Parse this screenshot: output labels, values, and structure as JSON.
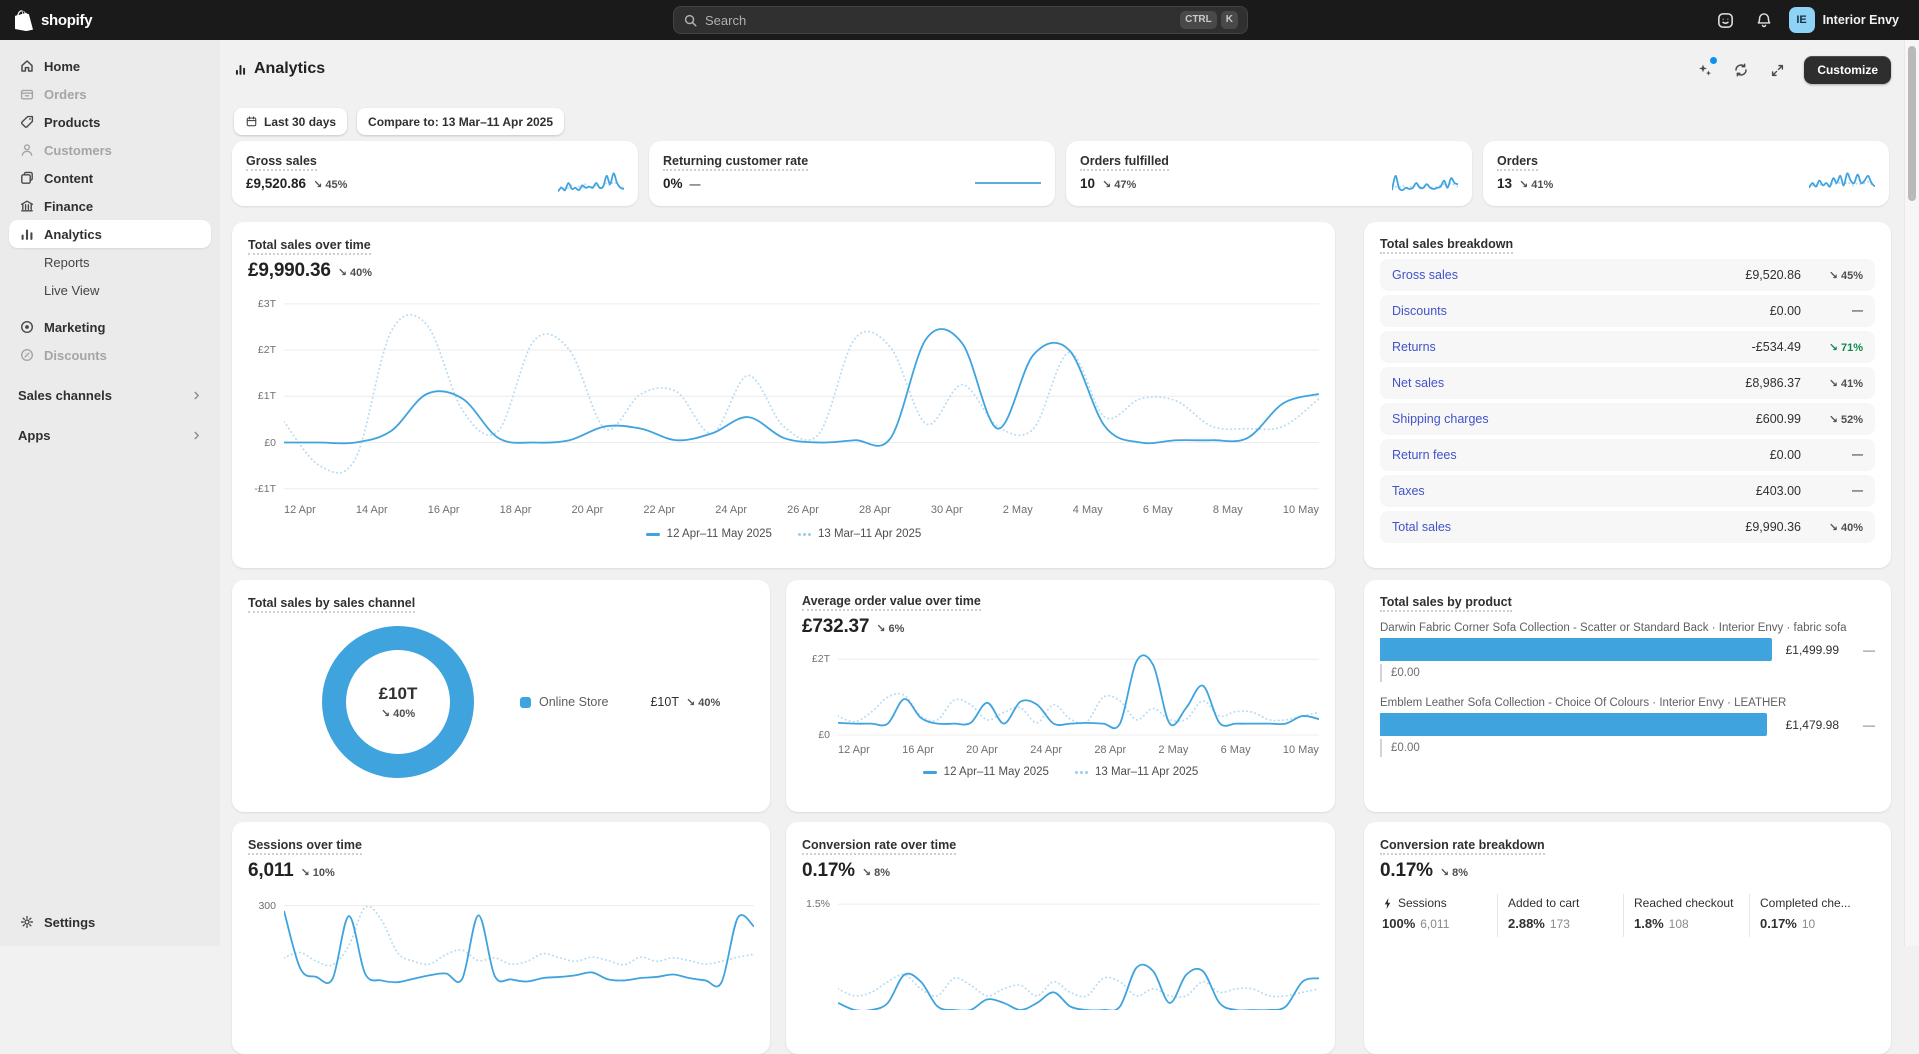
{
  "topbar": {
    "brand": "shopify",
    "search": {
      "placeholder": "Search",
      "keys": [
        "CTRL",
        "K"
      ]
    },
    "store": {
      "initials": "IE",
      "name": "Interior Envy"
    }
  },
  "sidebar": {
    "items": [
      {
        "label": "Home"
      },
      {
        "label": "Orders"
      },
      {
        "label": "Products"
      },
      {
        "label": "Customers"
      },
      {
        "label": "Content"
      },
      {
        "label": "Finance"
      },
      {
        "label": "Analytics"
      },
      {
        "label": "Reports"
      },
      {
        "label": "Live View"
      },
      {
        "label": "Marketing"
      },
      {
        "label": "Discounts"
      }
    ],
    "sections": [
      {
        "label": "Sales channels"
      },
      {
        "label": "Apps"
      }
    ],
    "settings": "Settings"
  },
  "header": {
    "title": "Analytics",
    "customize": "Customize"
  },
  "filters": {
    "range": "Last 30 days",
    "compare": "Compare to: 13 Mar–11 Apr 2025"
  },
  "metrics": [
    {
      "title": "Gross sales",
      "value": "£9,520.86",
      "change": "↘ 45%"
    },
    {
      "title": "Returning customer rate",
      "value": "0%",
      "change": "—"
    },
    {
      "title": "Orders fulfilled",
      "value": "10",
      "change": "↘ 47%"
    },
    {
      "title": "Orders",
      "value": "13",
      "change": "↘ 41%"
    }
  ],
  "big_chart": {
    "title": "Total sales over time",
    "value": "£9,990.36",
    "change": "↘ 40%",
    "legend_current": "12 Apr–11 May 2025",
    "legend_compare": "13 Mar–11 Apr 2025"
  },
  "breakdown": {
    "title": "Total sales breakdown",
    "rows": [
      {
        "label": "Gross sales",
        "value": "£9,520.86",
        "change": "↘ 45%"
      },
      {
        "label": "Discounts",
        "value": "£0.00",
        "change": "—"
      },
      {
        "label": "Returns",
        "value": "-£534.49",
        "change": "↘ 71%",
        "color": "#0f8a4e"
      },
      {
        "label": "Net sales",
        "value": "£8,986.37",
        "change": "↘ 41%"
      },
      {
        "label": "Shipping charges",
        "value": "£600.99",
        "change": "↘ 52%"
      },
      {
        "label": "Return fees",
        "value": "£0.00",
        "change": "—"
      },
      {
        "label": "Taxes",
        "value": "£403.00",
        "change": "—"
      },
      {
        "label": "Total sales",
        "value": "£9,990.36",
        "change": "↘ 40%"
      }
    ]
  },
  "channel": {
    "title": "Total sales by sales channel",
    "center_value": "£10T",
    "center_change": "↘ 40%",
    "legend_name": "Online Store",
    "legend_value": "£10T",
    "legend_change": "↘ 40%"
  },
  "aov": {
    "title": "Average order value over time",
    "value": "£732.37",
    "change": "↘ 6%",
    "legend_current": "12 Apr–11 May 2025",
    "legend_compare": "13 Mar–11 Apr 2025"
  },
  "product_sales": {
    "title": "Total sales by product",
    "axis_max": 1512,
    "items": [
      {
        "label": "Darwin Fabric Corner Sofa Collection - Scatter or Standard Back · Interior Envy · fabric sofa",
        "value": "£1,499.99",
        "value_num": 1499.99,
        "change": "—",
        "compare_value": "£0.00"
      },
      {
        "label": "Emblem Leather Sofa Collection - Choice Of Colours · Interior Envy · LEATHER",
        "value": "£1,479.98",
        "value_num": 1479.98,
        "change": "—",
        "compare_value": "£0.00"
      }
    ]
  },
  "sessions": {
    "title": "Sessions over time",
    "value": "6,011",
    "change": "↘ 10%"
  },
  "conversion": {
    "title": "Conversion rate over time",
    "value": "0.17%",
    "change": "↘ 8%"
  },
  "funnel": {
    "title": "Conversion rate breakdown",
    "value": "0.17%",
    "change": "↘ 8%",
    "columns": [
      {
        "label": "Sessions",
        "pct": "100%",
        "count": "6,011"
      },
      {
        "label": "Added to cart",
        "pct": "2.88%",
        "count": "173"
      },
      {
        "label": "Reached checkout",
        "pct": "1.8%",
        "count": "108"
      },
      {
        "label": "Completed che...",
        "pct": "0.17%",
        "count": "10"
      }
    ]
  },
  "colors": {
    "accent_blue": "#3fa3de",
    "compare_blue": "#b7dcf4",
    "link": "#4053c8",
    "green": "#0f8a4e"
  },
  "charts": {
    "total_sales": {
      "type": "line",
      "ylim": [
        -1.2,
        3.3
      ],
      "color": "#3fa3de",
      "compare_color": "#b7dcf4",
      "yticks": [
        {
          "label": "£3T",
          "value": 3
        },
        {
          "label": "£2T",
          "value": 2
        },
        {
          "label": "£1T",
          "value": 1
        },
        {
          "label": "£0",
          "value": 0
        },
        {
          "label": "-£1T",
          "value": -1
        }
      ],
      "xlabels": [
        "12 Apr",
        "14 Apr",
        "16 Apr",
        "18 Apr",
        "20 Apr",
        "22 Apr",
        "24 Apr",
        "26 Apr",
        "28 Apr",
        "30 Apr",
        "2 May",
        "4 May",
        "6 May",
        "8 May",
        "10 May"
      ],
      "series": [
        {
          "name": "13 Mar–11 Apr 2025",
          "style": "dotted",
          "values": [
            0.45,
            -0.5,
            -0.35,
            2.4,
            2.55,
            0.7,
            0.25,
            2.2,
            2.0,
            0.3,
            1.05,
            1.1,
            0.2,
            1.45,
            0.35,
            0.2,
            2.25,
            2.05,
            0.4,
            1.25,
            0.35,
            0.3,
            1.95,
            0.55,
            0.95,
            0.9,
            0.35,
            0.3,
            0.35,
            0.95
          ]
        },
        {
          "name": "12 Apr–11 May 2025",
          "style": "solid",
          "values": [
            0,
            0,
            0,
            0.25,
            1.05,
            0.95,
            0.1,
            0,
            0.05,
            0.35,
            0.3,
            0.05,
            0.2,
            0.55,
            0.1,
            0,
            0.05,
            0.1,
            2.25,
            2.15,
            0.3,
            1.9,
            2.0,
            0.35,
            0,
            0.05,
            0.05,
            0.1,
            0.85,
            1.05
          ]
        }
      ]
    },
    "aov_chart": {
      "type": "line",
      "ylim": [
        -0.08,
        2.35
      ],
      "color": "#3fa3de",
      "compare_color": "#b7dcf4",
      "yticks": [
        {
          "label": "£2T",
          "value": 2
        },
        {
          "label": "£0",
          "value": 0
        }
      ],
      "xlabels": [
        "12 Apr",
        "16 Apr",
        "20 Apr",
        "24 Apr",
        "28 Apr",
        "2 May",
        "6 May",
        "10 May"
      ],
      "series": [
        {
          "name": "13 Mar–11 Apr 2025",
          "style": "dotted",
          "values": [
            0.5,
            0.35,
            0.6,
            1.0,
            1.05,
            0.5,
            0.4,
            0.92,
            0.8,
            0.4,
            0.6,
            0.72,
            0.32,
            0.8,
            0.42,
            0.35,
            1.0,
            0.9,
            0.4,
            0.7,
            0.4,
            0.42,
            0.9,
            0.5,
            0.62,
            0.6,
            0.4,
            0.4,
            0.5,
            0.6
          ]
        },
        {
          "name": "12 Apr–11 May 2025",
          "style": "solid",
          "values": [
            0.32,
            0.3,
            0.3,
            0.3,
            0.95,
            0.45,
            0.3,
            0.3,
            0.32,
            0.85,
            0.3,
            0.88,
            0.8,
            0.3,
            0.3,
            0.32,
            0.3,
            0.3,
            1.95,
            1.85,
            0.3,
            0.72,
            1.3,
            0.32,
            0.3,
            0.3,
            0.3,
            0.3,
            0.5,
            0.42
          ]
        }
      ]
    },
    "sessions_chart": {
      "type": "line",
      "ylim": [
        0,
        345
      ],
      "color": "#3fa3de",
      "compare_color": "#b7dcf4",
      "yticks": [
        {
          "label": "300",
          "value": 300
        }
      ],
      "series": [
        {
          "name": "13 Mar–11 Apr 2025",
          "style": "dotted",
          "values": [
            150,
            165,
            140,
            130,
            185,
            295,
            260,
            165,
            140,
            132,
            160,
            172,
            142,
            150,
            132,
            140,
            162,
            150,
            140,
            152,
            142,
            130,
            152,
            140,
            150,
            142,
            132,
            140,
            152,
            160
          ]
        },
        {
          "name": "12 Apr–11 May 2025",
          "style": "solid",
          "values": [
            285,
            120,
            95,
            90,
            270,
            105,
            85,
            80,
            90,
            100,
            105,
            90,
            272,
            98,
            88,
            82,
            92,
            95,
            100,
            108,
            88,
            85,
            92,
            95,
            102,
            92,
            85,
            80,
            265,
            240
          ]
        }
      ]
    },
    "conversion_chart": {
      "type": "line",
      "ylim": [
        0,
        1.7
      ],
      "color": "#3fa3de",
      "compare_color": "#b7dcf4",
      "yticks": [
        {
          "label": "1.5%",
          "value": 1.5
        }
      ],
      "series": [
        {
          "name": "13 Mar–11 Apr 2025",
          "style": "dotted",
          "values": [
            0.3,
            0.2,
            0.25,
            0.4,
            0.5,
            0.3,
            0.2,
            0.45,
            0.35,
            0.2,
            0.3,
            0.35,
            0.2,
            0.4,
            0.25,
            0.2,
            0.45,
            0.4,
            0.2,
            0.3,
            0.2,
            0.2,
            0.4,
            0.25,
            0.3,
            0.3,
            0.2,
            0.2,
            0.25,
            0.3
          ]
        },
        {
          "name": "12 Apr–11 May 2025",
          "style": "solid",
          "values": [
            0.1,
            0,
            0,
            0.1,
            0.5,
            0.4,
            0.05,
            0,
            0,
            0.15,
            0.1,
            0,
            0.1,
            0.25,
            0.05,
            0,
            0,
            0.05,
            0.6,
            0.55,
            0.1,
            0.5,
            0.55,
            0.1,
            0,
            0,
            0,
            0.05,
            0.4,
            0.45
          ]
        }
      ]
    },
    "spark0": {
      "type": "line",
      "ylim": [
        0,
        1
      ],
      "color": "#3fa3de",
      "compare_color": "#b7dcf4",
      "series": [
        {
          "style": "dotted",
          "values": [
            0.2,
            0.35,
            0.25,
            0.3,
            0.4,
            0.3,
            0.35,
            0.3,
            0.45,
            0.3,
            0.35,
            0.4,
            0.3,
            0.35,
            0.5,
            0.4,
            0.55,
            0.45,
            0.35,
            0.3
          ]
        },
        {
          "style": "solid",
          "values": [
            0.15,
            0.3,
            0.2,
            0.5,
            0.25,
            0.3,
            0.2,
            0.4,
            0.3,
            0.35,
            0.3,
            0.5,
            0.3,
            0.35,
            0.8,
            0.45,
            0.9,
            0.5,
            0.3,
            0.25
          ]
        }
      ]
    },
    "spark1": {
      "type": "line",
      "ylim": [
        0,
        1
      ],
      "color": "#3fa3de",
      "compare_color": "#b7dcf4",
      "series": [
        {
          "style": "solid",
          "values": [
            0.5,
            0.5,
            0.5,
            0.5,
            0.5,
            0.5,
            0.5,
            0.5
          ]
        }
      ]
    },
    "spark2": {
      "type": "line",
      "ylim": [
        0,
        1
      ],
      "color": "#3fa3de",
      "compare_color": "#b7dcf4",
      "series": [
        {
          "style": "dotted",
          "values": [
            0.3,
            0.35,
            0.3,
            0.4,
            0.3,
            0.35,
            0.3,
            0.45,
            0.35,
            0.3,
            0.4,
            0.35,
            0.3,
            0.35,
            0.4,
            0.45,
            0.35,
            0.5,
            0.4,
            0.35
          ]
        },
        {
          "style": "solid",
          "values": [
            0.2,
            0.8,
            0.3,
            0.2,
            0.3,
            0.25,
            0.3,
            0.5,
            0.3,
            0.3,
            0.45,
            0.3,
            0.25,
            0.3,
            0.35,
            0.6,
            0.3,
            0.7,
            0.5,
            0.45
          ]
        }
      ]
    },
    "spark3": {
      "type": "line",
      "ylim": [
        0,
        1
      ],
      "color": "#3fa3de",
      "compare_color": "#b7dcf4",
      "series": [
        {
          "style": "dotted",
          "values": [
            0.35,
            0.4,
            0.35,
            0.45,
            0.4,
            0.45,
            0.4,
            0.5,
            0.45,
            0.5,
            0.4,
            0.55,
            0.45,
            0.4,
            0.5,
            0.45,
            0.5,
            0.55,
            0.45,
            0.4
          ]
        },
        {
          "style": "solid",
          "values": [
            0.3,
            0.5,
            0.35,
            0.6,
            0.4,
            0.5,
            0.35,
            0.7,
            0.5,
            0.8,
            0.4,
            0.9,
            0.6,
            0.5,
            0.85,
            0.5,
            0.6,
            0.8,
            0.5,
            0.35
          ]
        }
      ]
    }
  }
}
